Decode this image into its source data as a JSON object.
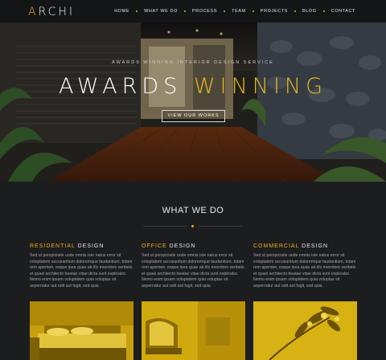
{
  "nav": {
    "logo_prefix": "A",
    "logo_rest": "RCHI",
    "items": [
      "HOME",
      "WHAT WE DO",
      "PROCESS",
      "TEAM",
      "PROJECTS",
      "BLOG",
      "CONTACT"
    ]
  },
  "hero": {
    "subtitle": "AWARDS WINNING INTERIOR DESIGN SERVICE",
    "title_white": "AWARDS",
    "title_accent": "WINNING",
    "button": "VIEW OUR WORKS"
  },
  "section": {
    "title": "WHAT WE DO"
  },
  "columns": [
    {
      "accent": "RESIDENTIAL",
      "rest": "DESIGN",
      "text": "Sed ut perspiciatis unde omnis iste natus error sit voluptatem accusantium doloremque laudantium, totam rem aperiam, eaque ipsa quae ab illo inventore veritatis et quasi architecto beatae vitae dicta sunt explicabo. Nemo enim ipsam voluptatem quia voluptas sit aspernatur aut odit aut fugit, sed quia",
      "image": "bedroom-photo"
    },
    {
      "accent": "OFFICE",
      "rest": "DESIGN",
      "text": "Sed ut perspiciatis unde omnis iste natus error sit voluptatem accusantium doloremque laudantium, totam rem aperiam, eaque ipsa quae ab illo inventore veritatis et quasi architecto beatae vitae dicta sunt explicabo. Nemo enim ipsam voluptatem quia voluptas sit aspernatur aut odit aut fugit, sed quia",
      "image": "office-chair-photo"
    },
    {
      "accent": "COMMERCIAL",
      "rest": "DESIGN",
      "text": "Sed ut perspiciatis unde omnis iste natus error sit voluptatem accusantium doloremque laudantium, totam rem aperiam, eaque ipsa quae ab illo inventore veritatis et quasi architecto beatae vitae dicta sunt explicabo. Nemo enim ipsam voluptatem quia voluptas sit aspernatur aut odit aut fugit, sed quia",
      "image": "plant-photo"
    }
  ],
  "colors": {
    "accent": "#e7b71d",
    "background": "#1c1d1f",
    "nav": "#141516"
  }
}
